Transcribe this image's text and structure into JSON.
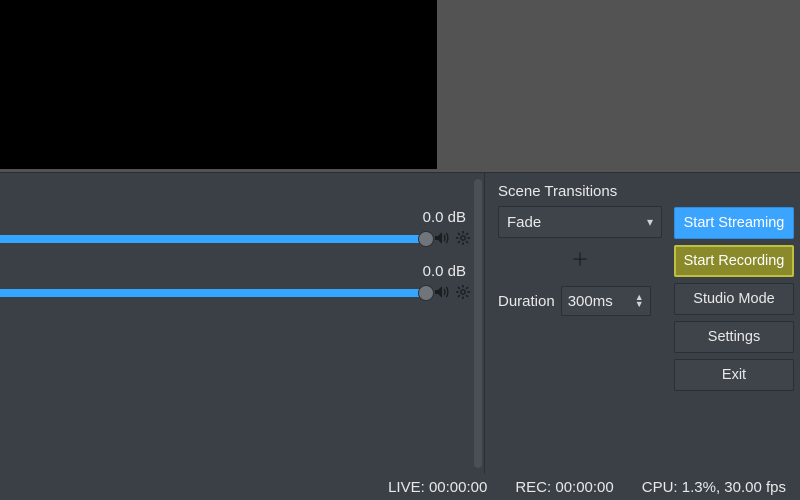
{
  "mixer": {
    "channels": [
      {
        "db": "0.0 dB"
      },
      {
        "db": "0.0 dB"
      }
    ]
  },
  "transitions": {
    "title": "Scene Transitions",
    "selected": "Fade",
    "durationLabel": "Duration",
    "durationValue": "300ms"
  },
  "controls": {
    "startStreaming": "Start Streaming",
    "startRecording": "Start Recording",
    "studioMode": "Studio Mode",
    "settings": "Settings",
    "exit": "Exit"
  },
  "status": {
    "live": "LIVE: 00:00:00",
    "rec": "REC: 00:00:00",
    "cpu": "CPU: 1.3%, 30.00 fps"
  }
}
